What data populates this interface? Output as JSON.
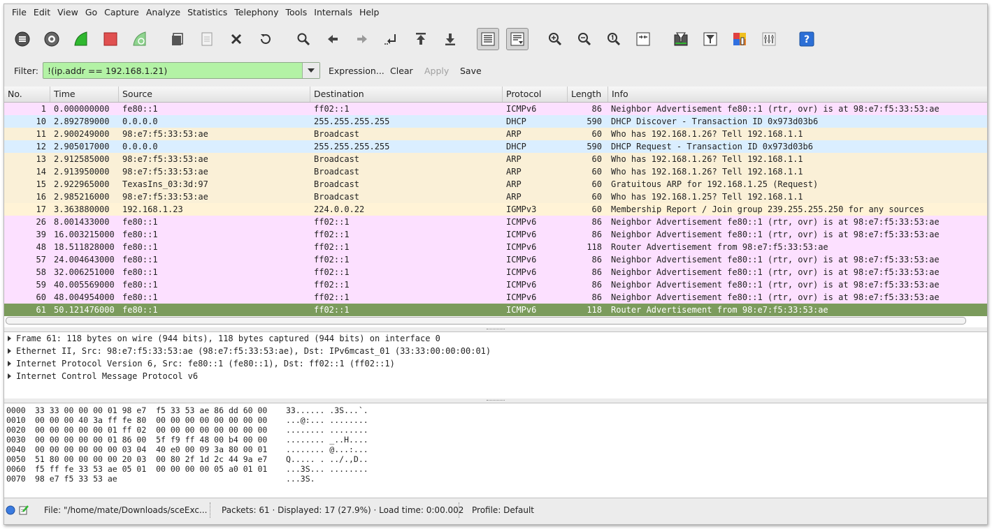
{
  "menu": [
    "File",
    "Edit",
    "View",
    "Go",
    "Capture",
    "Analyze",
    "Statistics",
    "Telephony",
    "Tools",
    "Internals",
    "Help"
  ],
  "toolbar": {
    "icons": [
      "list-interfaces-icon",
      "capture-options-icon",
      "start-capture-icon",
      "stop-capture-icon",
      "restart-capture-icon",
      "open-file-icon",
      "save-file-icon",
      "close-file-icon",
      "reload-icon",
      "find-packet-icon",
      "go-back-icon",
      "go-forward-icon",
      "go-to-packet-icon",
      "first-packet-icon",
      "last-packet-icon",
      "colorize-icon",
      "auto-scroll-icon",
      "zoom-in-icon",
      "zoom-out-icon",
      "normal-size-icon",
      "resize-columns-icon",
      "capture-filters-icon",
      "display-filters-icon",
      "coloring-rules-icon",
      "preferences-icon",
      "help-icon"
    ]
  },
  "filter": {
    "label": "Filter:",
    "value": "!(ip.addr == 192.168.1.21)",
    "expression_label": "Expression...",
    "clear_label": "Clear",
    "apply_label": "Apply",
    "save_label": "Save",
    "bg_color": "#b3f2a5"
  },
  "columns": [
    "No.",
    "Time",
    "Source",
    "Destination",
    "Protocol",
    "Length",
    "Info"
  ],
  "colors": {
    "icmpv6": "#fce0ff",
    "dhcp": "#daeeff",
    "arp": "#faf0d7",
    "igmp": "#fff3d6",
    "selected": "#7b9b5c"
  },
  "packets": [
    {
      "no": "1",
      "time": "0.000000000",
      "src": "fe80::1",
      "dst": "ff02::1",
      "proto": "ICMPv6",
      "len": "86",
      "info": "Neighbor Advertisement fe80::1 (rtr, ovr) is at 98:e7:f5:33:53:ae",
      "kind": "icmpv6"
    },
    {
      "no": "10",
      "time": "2.892789000",
      "src": "0.0.0.0",
      "dst": "255.255.255.255",
      "proto": "DHCP",
      "len": "590",
      "info": "DHCP Discover - Transaction ID 0x973d03b6",
      "kind": "dhcp"
    },
    {
      "no": "11",
      "time": "2.900249000",
      "src": "98:e7:f5:33:53:ae",
      "dst": "Broadcast",
      "proto": "ARP",
      "len": "60",
      "info": "Who has 192.168.1.26?  Tell 192.168.1.1",
      "kind": "arp"
    },
    {
      "no": "12",
      "time": "2.905017000",
      "src": "0.0.0.0",
      "dst": "255.255.255.255",
      "proto": "DHCP",
      "len": "590",
      "info": "DHCP Request  - Transaction ID 0x973d03b6",
      "kind": "dhcp"
    },
    {
      "no": "13",
      "time": "2.912585000",
      "src": "98:e7:f5:33:53:ae",
      "dst": "Broadcast",
      "proto": "ARP",
      "len": "60",
      "info": "Who has 192.168.1.26?  Tell 192.168.1.1",
      "kind": "arp"
    },
    {
      "no": "14",
      "time": "2.913950000",
      "src": "98:e7:f5:33:53:ae",
      "dst": "Broadcast",
      "proto": "ARP",
      "len": "60",
      "info": "Who has 192.168.1.26?  Tell 192.168.1.1",
      "kind": "arp"
    },
    {
      "no": "15",
      "time": "2.922965000",
      "src": "TexasIns_03:3d:97",
      "dst": "Broadcast",
      "proto": "ARP",
      "len": "60",
      "info": "Gratuitous ARP for 192.168.1.25 (Request)",
      "kind": "arp"
    },
    {
      "no": "16",
      "time": "2.985216000",
      "src": "98:e7:f5:33:53:ae",
      "dst": "Broadcast",
      "proto": "ARP",
      "len": "60",
      "info": "Who has 192.168.1.25?  Tell 192.168.1.1",
      "kind": "arp"
    },
    {
      "no": "17",
      "time": "3.363880000",
      "src": "192.168.1.23",
      "dst": "224.0.0.22",
      "proto": "IGMPv3",
      "len": "60",
      "info": "Membership Report / Join group 239.255.255.250 for any sources",
      "kind": "igmp"
    },
    {
      "no": "26",
      "time": "8.001433000",
      "src": "fe80::1",
      "dst": "ff02::1",
      "proto": "ICMPv6",
      "len": "86",
      "info": "Neighbor Advertisement fe80::1 (rtr, ovr) is at 98:e7:f5:33:53:ae",
      "kind": "icmpv6"
    },
    {
      "no": "39",
      "time": "16.003215000",
      "src": "fe80::1",
      "dst": "ff02::1",
      "proto": "ICMPv6",
      "len": "86",
      "info": "Neighbor Advertisement fe80::1 (rtr, ovr) is at 98:e7:f5:33:53:ae",
      "kind": "icmpv6"
    },
    {
      "no": "48",
      "time": "18.511828000",
      "src": "fe80::1",
      "dst": "ff02::1",
      "proto": "ICMPv6",
      "len": "118",
      "info": "Router Advertisement from 98:e7:f5:33:53:ae",
      "kind": "icmpv6"
    },
    {
      "no": "57",
      "time": "24.004643000",
      "src": "fe80::1",
      "dst": "ff02::1",
      "proto": "ICMPv6",
      "len": "86",
      "info": "Neighbor Advertisement fe80::1 (rtr, ovr) is at 98:e7:f5:33:53:ae",
      "kind": "icmpv6"
    },
    {
      "no": "58",
      "time": "32.006251000",
      "src": "fe80::1",
      "dst": "ff02::1",
      "proto": "ICMPv6",
      "len": "86",
      "info": "Neighbor Advertisement fe80::1 (rtr, ovr) is at 98:e7:f5:33:53:ae",
      "kind": "icmpv6"
    },
    {
      "no": "59",
      "time": "40.005569000",
      "src": "fe80::1",
      "dst": "ff02::1",
      "proto": "ICMPv6",
      "len": "86",
      "info": "Neighbor Advertisement fe80::1 (rtr, ovr) is at 98:e7:f5:33:53:ae",
      "kind": "icmpv6"
    },
    {
      "no": "60",
      "time": "48.004954000",
      "src": "fe80::1",
      "dst": "ff02::1",
      "proto": "ICMPv6",
      "len": "86",
      "info": "Neighbor Advertisement fe80::1 (rtr, ovr) is at 98:e7:f5:33:53:ae",
      "kind": "icmpv6"
    },
    {
      "no": "61",
      "time": "50.121476000",
      "src": "fe80::1",
      "dst": "ff02::1",
      "proto": "ICMPv6",
      "len": "118",
      "info": "Router Advertisement from 98:e7:f5:33:53:ae",
      "kind": "selected"
    }
  ],
  "details": [
    "Frame 61: 118 bytes on wire (944 bits), 118 bytes captured (944 bits) on interface 0",
    "Ethernet II, Src: 98:e7:f5:33:53:ae (98:e7:f5:33:53:ae), Dst: IPv6mcast_01 (33:33:00:00:00:01)",
    "Internet Protocol Version 6, Src: fe80::1 (fe80::1), Dst: ff02::1 (ff02::1)",
    "Internet Control Message Protocol v6"
  ],
  "hex": [
    {
      "off": "0000",
      "hex": "33 33 00 00 00 01 98 e7  f5 33 53 ae 86 dd 60 00",
      "ascii": "33...... .3S...`."
    },
    {
      "off": "0010",
      "hex": "00 00 00 40 3a ff fe 80  00 00 00 00 00 00 00 00",
      "ascii": "...@:... ........"
    },
    {
      "off": "0020",
      "hex": "00 00 00 00 00 01 ff 02  00 00 00 00 00 00 00 00",
      "ascii": "........ ........"
    },
    {
      "off": "0030",
      "hex": "00 00 00 00 00 01 86 00  5f f9 ff 48 00 b4 00 00",
      "ascii": "........ _..H...."
    },
    {
      "off": "0040",
      "hex": "00 00 00 00 00 00 03 04  40 e0 00 09 3a 80 00 01",
      "ascii": "........ @...:..."
    },
    {
      "off": "0050",
      "hex": "51 80 00 00 00 00 20 03  00 80 2f 1d 2c 44 9a e7",
      "ascii": "Q..... . ../.,D.."
    },
    {
      "off": "0060",
      "hex": "f5 ff fe 33 53 ae 05 01  00 00 00 00 05 a0 01 01",
      "ascii": "...3S... ........"
    },
    {
      "off": "0070",
      "hex": "98 e7 f5 33 53 ae",
      "ascii": "...3S."
    }
  ],
  "status": {
    "file": "File: \"/home/mate/Downloads/sceExc...",
    "packets": "Packets: 61 · Displayed: 17 (27.9%) · Load time: 0:00.002",
    "profile": "Profile: Default"
  }
}
